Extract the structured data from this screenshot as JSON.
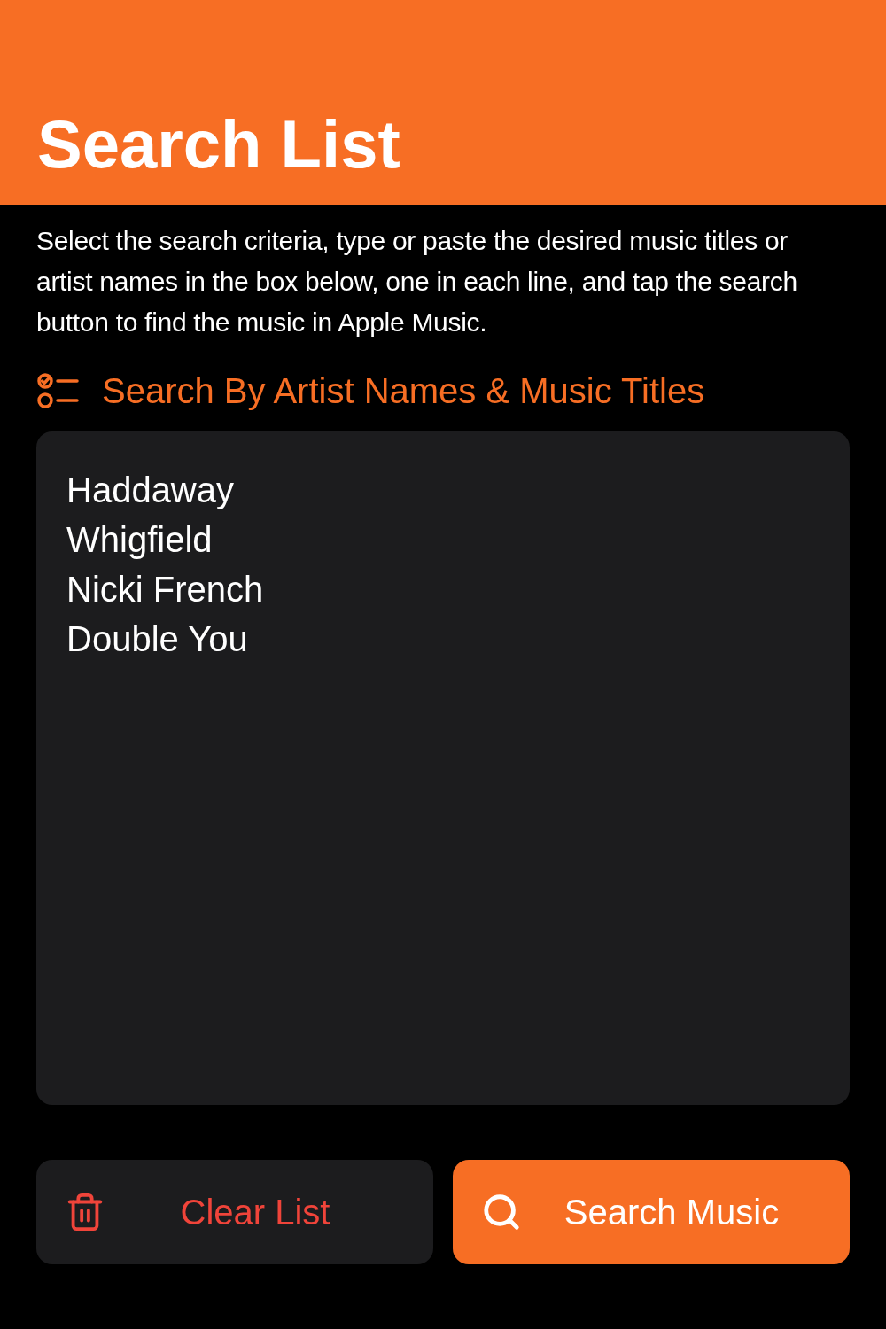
{
  "header": {
    "title": "Search List"
  },
  "description": "Select the search criteria, type or paste the desired music titles or artist names in the box below, one in each line, and tap the search button to find the music in Apple Music.",
  "criteria": {
    "label": "Search By Artist Names & Music Titles"
  },
  "list_field": {
    "value": "Haddaway\nWhigfield\nNicki French\nDouble You"
  },
  "buttons": [
    {
      "kind": "clear",
      "label": "Clear List"
    },
    {
      "kind": "search",
      "label": "Search Music"
    }
  ]
}
